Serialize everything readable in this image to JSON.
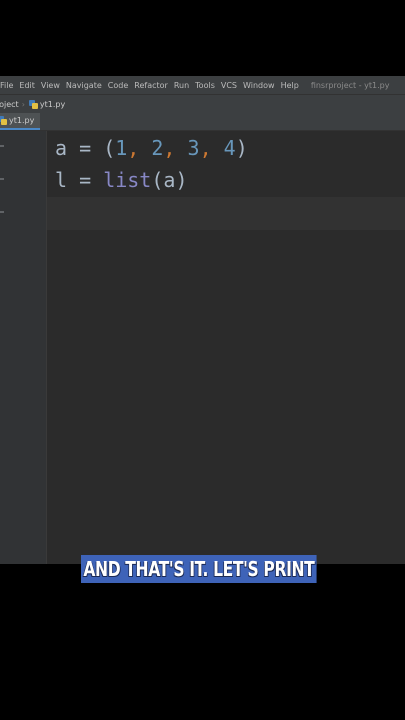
{
  "menubar": {
    "items": [
      "File",
      "Edit",
      "View",
      "Navigate",
      "Code",
      "Refactor",
      "Run",
      "Tools",
      "VCS",
      "Window",
      "Help"
    ],
    "window_title": "finsrproject - yt1.py"
  },
  "navbar": {
    "project": "roject",
    "file": "yt1.py"
  },
  "tabs": [
    {
      "label": "yt1.py",
      "active": true
    }
  ],
  "editor": {
    "lines": [
      {
        "var": "a",
        "op": "=",
        "open": "(",
        "nums": [
          "1",
          "2",
          "3",
          "4"
        ],
        "close": ")"
      },
      {
        "var": "l",
        "op": "=",
        "fn": "list",
        "arg_open": "(",
        "arg": "a",
        "arg_close": ")"
      }
    ]
  },
  "caption": "AND THAT'S IT. LET'S PRINT",
  "colors": {
    "editor_bg": "#2b2b2b",
    "number": "#6897bb",
    "comma": "#cc7832",
    "builtin": "#8888c6",
    "caption_bg": "#3e63b8"
  }
}
